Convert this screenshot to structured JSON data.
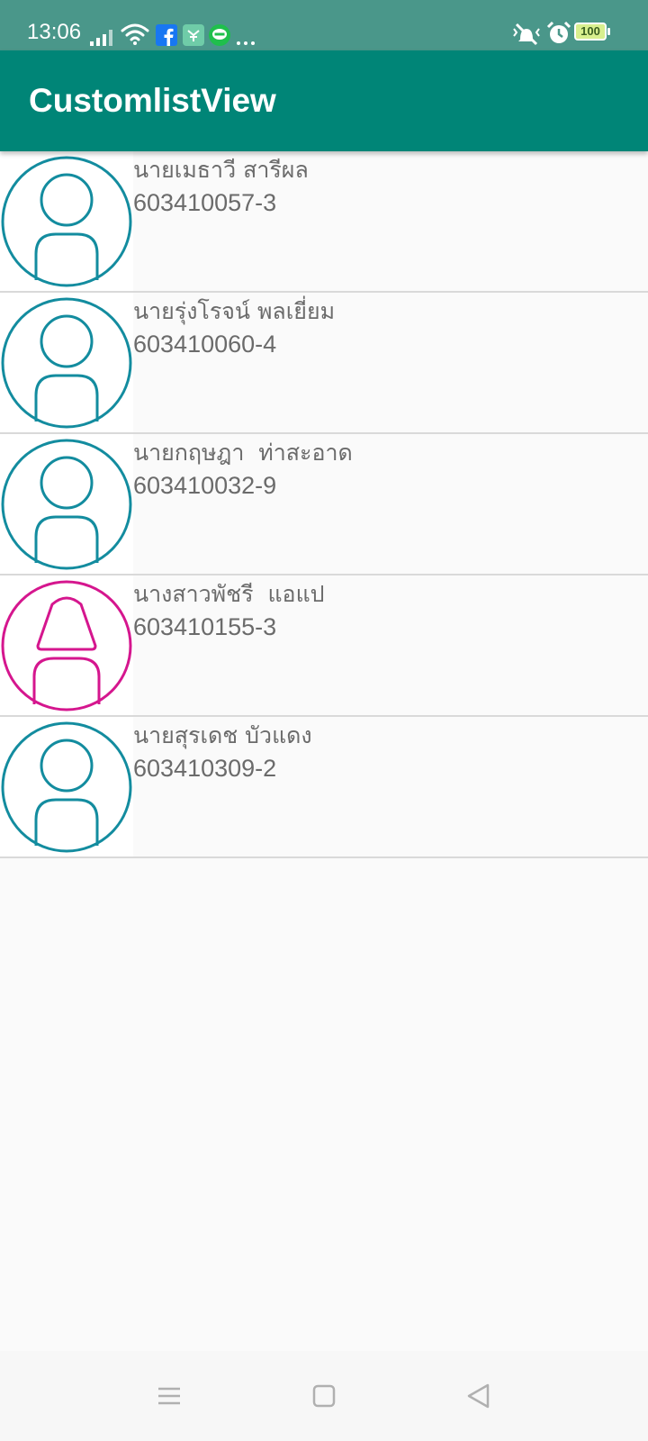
{
  "status_bar": {
    "time": "13:06",
    "battery": "100",
    "icons": [
      "signal-icon",
      "wifi-icon",
      "facebook-icon",
      "app-notification-icon",
      "line-icon",
      "more-icon",
      "mute-vibrate-icon",
      "alarm-icon",
      "battery-icon"
    ]
  },
  "app_bar": {
    "title": "CustomlistView"
  },
  "colors": {
    "primary": "#008577",
    "status_bar": "#4a978a",
    "male_avatar": "#138c9f",
    "female_avatar": "#d5168e"
  },
  "list": {
    "items": [
      {
        "name": "นายเมธาวี สารีผล",
        "id": "603410057-3",
        "avatar": "male-avatar-icon"
      },
      {
        "name": "นายรุ่งโรจน์ พลเยี่ยม",
        "id": "603410060-4",
        "avatar": "male-avatar-icon"
      },
      {
        "name": "นายกฤษฎา  ท่าสะอาด",
        "id": "603410032-9",
        "avatar": "male-avatar-icon"
      },
      {
        "name": "นางสาวพัชรี  แอแป",
        "id": "603410155-3",
        "avatar": "female-avatar-icon"
      },
      {
        "name": "นายสุรเดช บัวแดง",
        "id": "603410309-2",
        "avatar": "male-avatar-icon"
      }
    ]
  },
  "nav_bar": {
    "buttons": [
      "menu-icon",
      "home-icon",
      "back-icon"
    ]
  }
}
